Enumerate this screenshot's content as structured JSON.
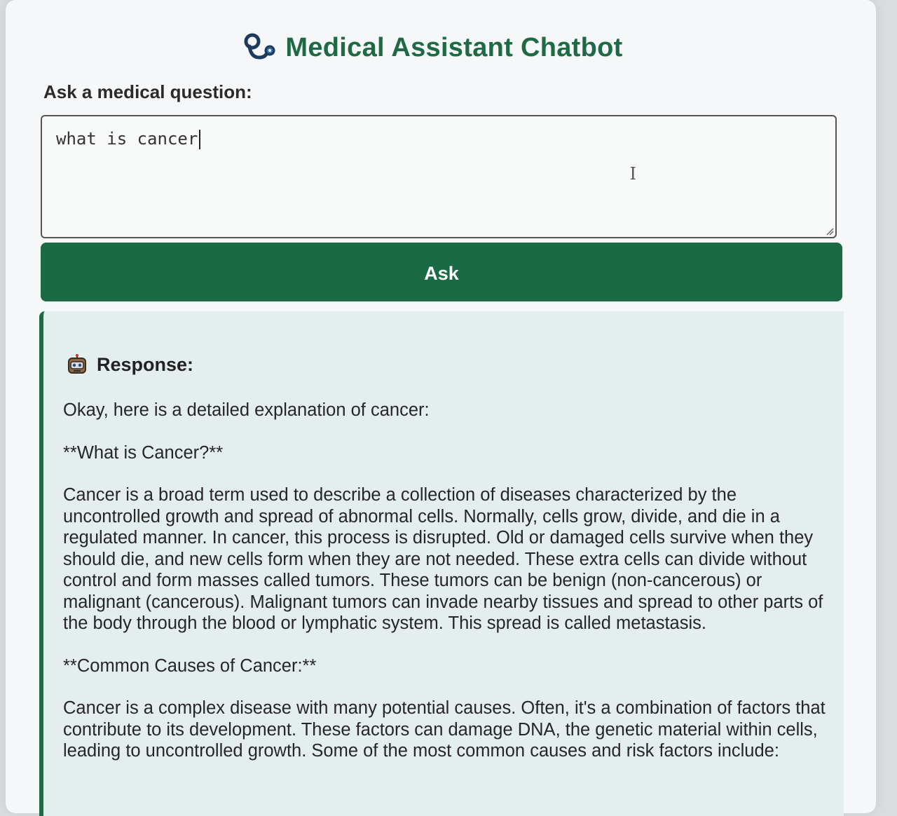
{
  "header": {
    "icon": "stethoscope-icon",
    "title": "Medical Assistant Chatbot"
  },
  "form": {
    "label": "Ask a medical question:",
    "input_value": "what is cancer",
    "ask_label": "Ask"
  },
  "response": {
    "icon": "robot-icon",
    "title": "Response:",
    "paragraphs": [
      "Okay, here is a detailed explanation of cancer:",
      "**What is Cancer?**",
      "Cancer is a broad term used to describe a collection of diseases characterized by the uncontrolled growth and spread of abnormal cells. Normally, cells grow, divide, and die in a regulated manner. In cancer, this process is disrupted. Old or damaged cells survive when they should die, and new cells form when they are not needed. These extra cells can divide without control and form masses called tumors. These tumors can be benign (non-cancerous) or malignant (cancerous). Malignant tumors can invade nearby tissues and spread to other parts of the body through the blood or lymphatic system. This spread is called metastasis.",
      "**Common Causes of Cancer:**",
      "Cancer is a complex disease with many potential causes. Often, it's a combination of factors that contribute to its development. These factors can damage DNA, the genetic material within cells, leading to uncontrolled growth. Some of the most common causes and risk factors include:"
    ]
  },
  "colors": {
    "accent": "#1a6a45",
    "title": "#1f6a45",
    "panel_bg": "#e5eeef"
  }
}
